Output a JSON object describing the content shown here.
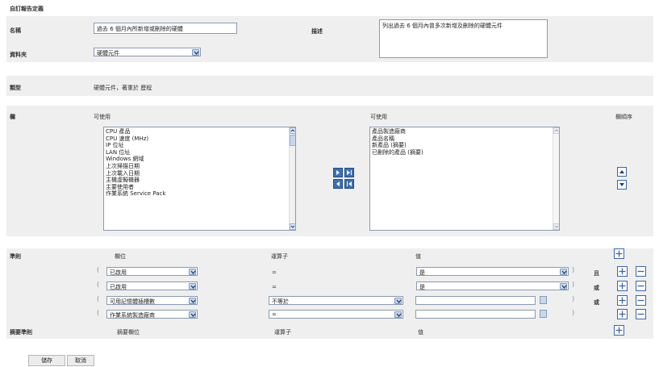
{
  "page_title": "自訂報告定義",
  "fields": {
    "name_label": "名稱",
    "name_value": "過去 6 個月內所新增或刪除的硬體",
    "description_label": "描述",
    "description_value": "列出過去 6 個月內曾多次新增及刪除的硬體元件",
    "folder_label": "資料夾",
    "folder_value": "硬體元件",
    "type_label": "類型",
    "type_value": "硬體元件，著重於 歷程"
  },
  "columns": {
    "label": "欄",
    "available_header": "可使用",
    "selected_header": "可使用",
    "sort_header": "欄順序",
    "available_items": [
      "CPU 產品",
      "CPU 速度 (MHz)",
      "IP 位址",
      "LAN 位址",
      "Windows 網域",
      "上次掃描日期",
      "上次載入日期",
      "主機虛擬機器",
      "主要使用者",
      "作業系統 Service Pack"
    ],
    "selected_items": [
      "產品製造廠商",
      "產品名稱",
      "新產品 (摘要)",
      "已刪除的產品 (摘要)"
    ]
  },
  "criteria": {
    "label": "準則",
    "field_header": "欄位",
    "operator_header": "運算子",
    "value_header": "值",
    "rows": [
      {
        "field": "已啟用",
        "operator": "=",
        "value": "是",
        "connector": "且"
      },
      {
        "field": "已啟用",
        "operator": "=",
        "value": "是",
        "connector": "或"
      },
      {
        "field": "可用記憶體插槽數",
        "operator": "不等於",
        "value": "",
        "connector": "或"
      },
      {
        "field": "作業系統製造廠商",
        "operator": "=",
        "value": "",
        "connector": ""
      }
    ],
    "summary_label": "摘要準則",
    "summary_field_header": "摘要欄位",
    "summary_operator_header": "運算子",
    "summary_value_header": "值"
  },
  "actions": {
    "save_label": "儲存",
    "cancel_label": "取消"
  },
  "colors": {
    "accent": "#3a67a9",
    "band": "#efefef"
  }
}
